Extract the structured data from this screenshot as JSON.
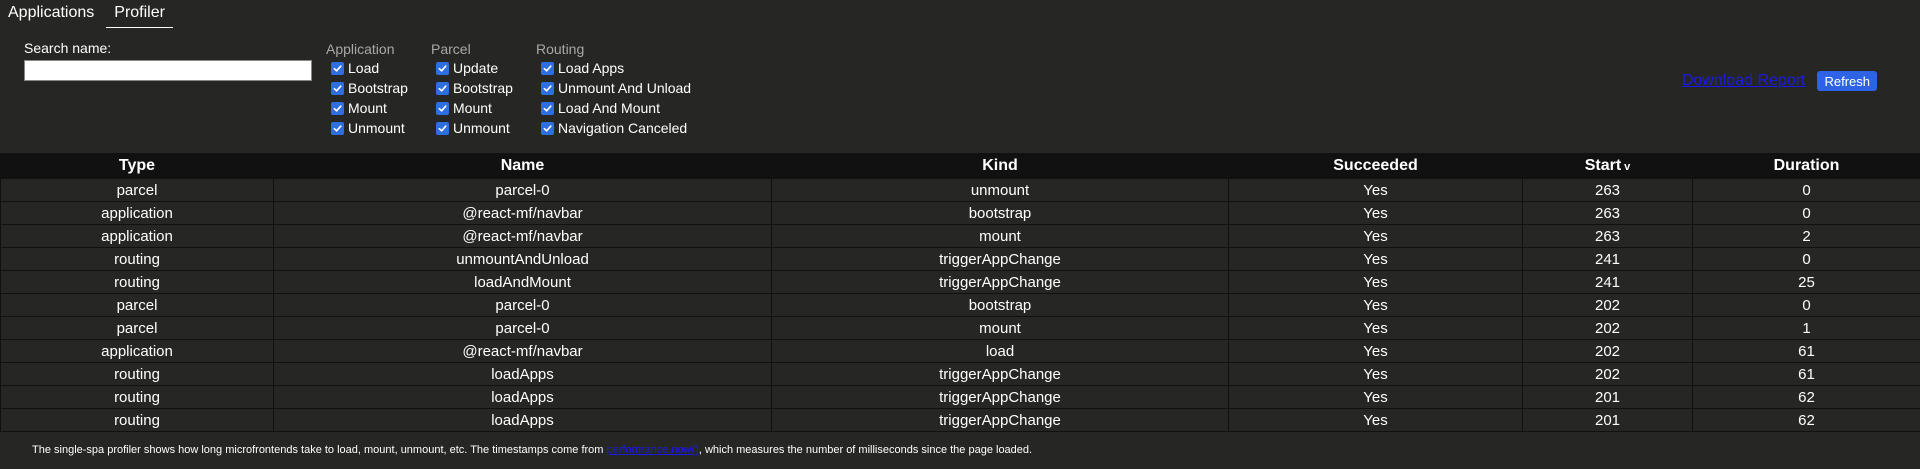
{
  "tabs": [
    {
      "label": "Applications"
    },
    {
      "label": "Profiler"
    }
  ],
  "search": {
    "label": "Search name:",
    "value": "",
    "placeholder": ""
  },
  "filter_groups": [
    {
      "title": "Application",
      "items": [
        "Load",
        "Bootstrap",
        "Mount",
        "Unmount"
      ]
    },
    {
      "title": "Parcel",
      "items": [
        "Update",
        "Bootstrap",
        "Mount",
        "Unmount"
      ]
    },
    {
      "title": "Routing",
      "items": [
        "Load Apps",
        "Unmount And Unload",
        "Load And Mount",
        "Navigation Canceled"
      ]
    }
  ],
  "actions": {
    "download_label": "Download Report",
    "refresh_label": "Refresh"
  },
  "table": {
    "columns": [
      "Type",
      "Name",
      "Kind",
      "Succeeded",
      "Start",
      "Duration"
    ],
    "sort_indicator": "v",
    "rows": [
      [
        "parcel",
        "parcel-0",
        "unmount",
        "Yes",
        "263",
        "0"
      ],
      [
        "application",
        "@react-mf/navbar",
        "bootstrap",
        "Yes",
        "263",
        "0"
      ],
      [
        "application",
        "@react-mf/navbar",
        "mount",
        "Yes",
        "263",
        "2"
      ],
      [
        "routing",
        "unmountAndUnload",
        "triggerAppChange",
        "Yes",
        "241",
        "0"
      ],
      [
        "routing",
        "loadAndMount",
        "triggerAppChange",
        "Yes",
        "241",
        "25"
      ],
      [
        "parcel",
        "parcel-0",
        "bootstrap",
        "Yes",
        "202",
        "0"
      ],
      [
        "parcel",
        "parcel-0",
        "mount",
        "Yes",
        "202",
        "1"
      ],
      [
        "application",
        "@react-mf/navbar",
        "load",
        "Yes",
        "202",
        "61"
      ],
      [
        "routing",
        "loadApps",
        "triggerAppChange",
        "Yes",
        "202",
        "61"
      ],
      [
        "routing",
        "loadApps",
        "triggerAppChange",
        "Yes",
        "201",
        "62"
      ],
      [
        "routing",
        "loadApps",
        "triggerAppChange",
        "Yes",
        "201",
        "62"
      ]
    ]
  },
  "footer": {
    "before": "The single-spa profiler shows how long microfrontends take to load, mount, unmount, etc. The timestamps come from ",
    "link": "performance.now()",
    "after": ", which measures the number of milliseconds since the page loaded."
  },
  "colors": {
    "background": "#262624",
    "header_bg": "#111111",
    "accent": "#2f63e6",
    "link": "#1a1ae8",
    "group_title": "#a8a8a8"
  }
}
